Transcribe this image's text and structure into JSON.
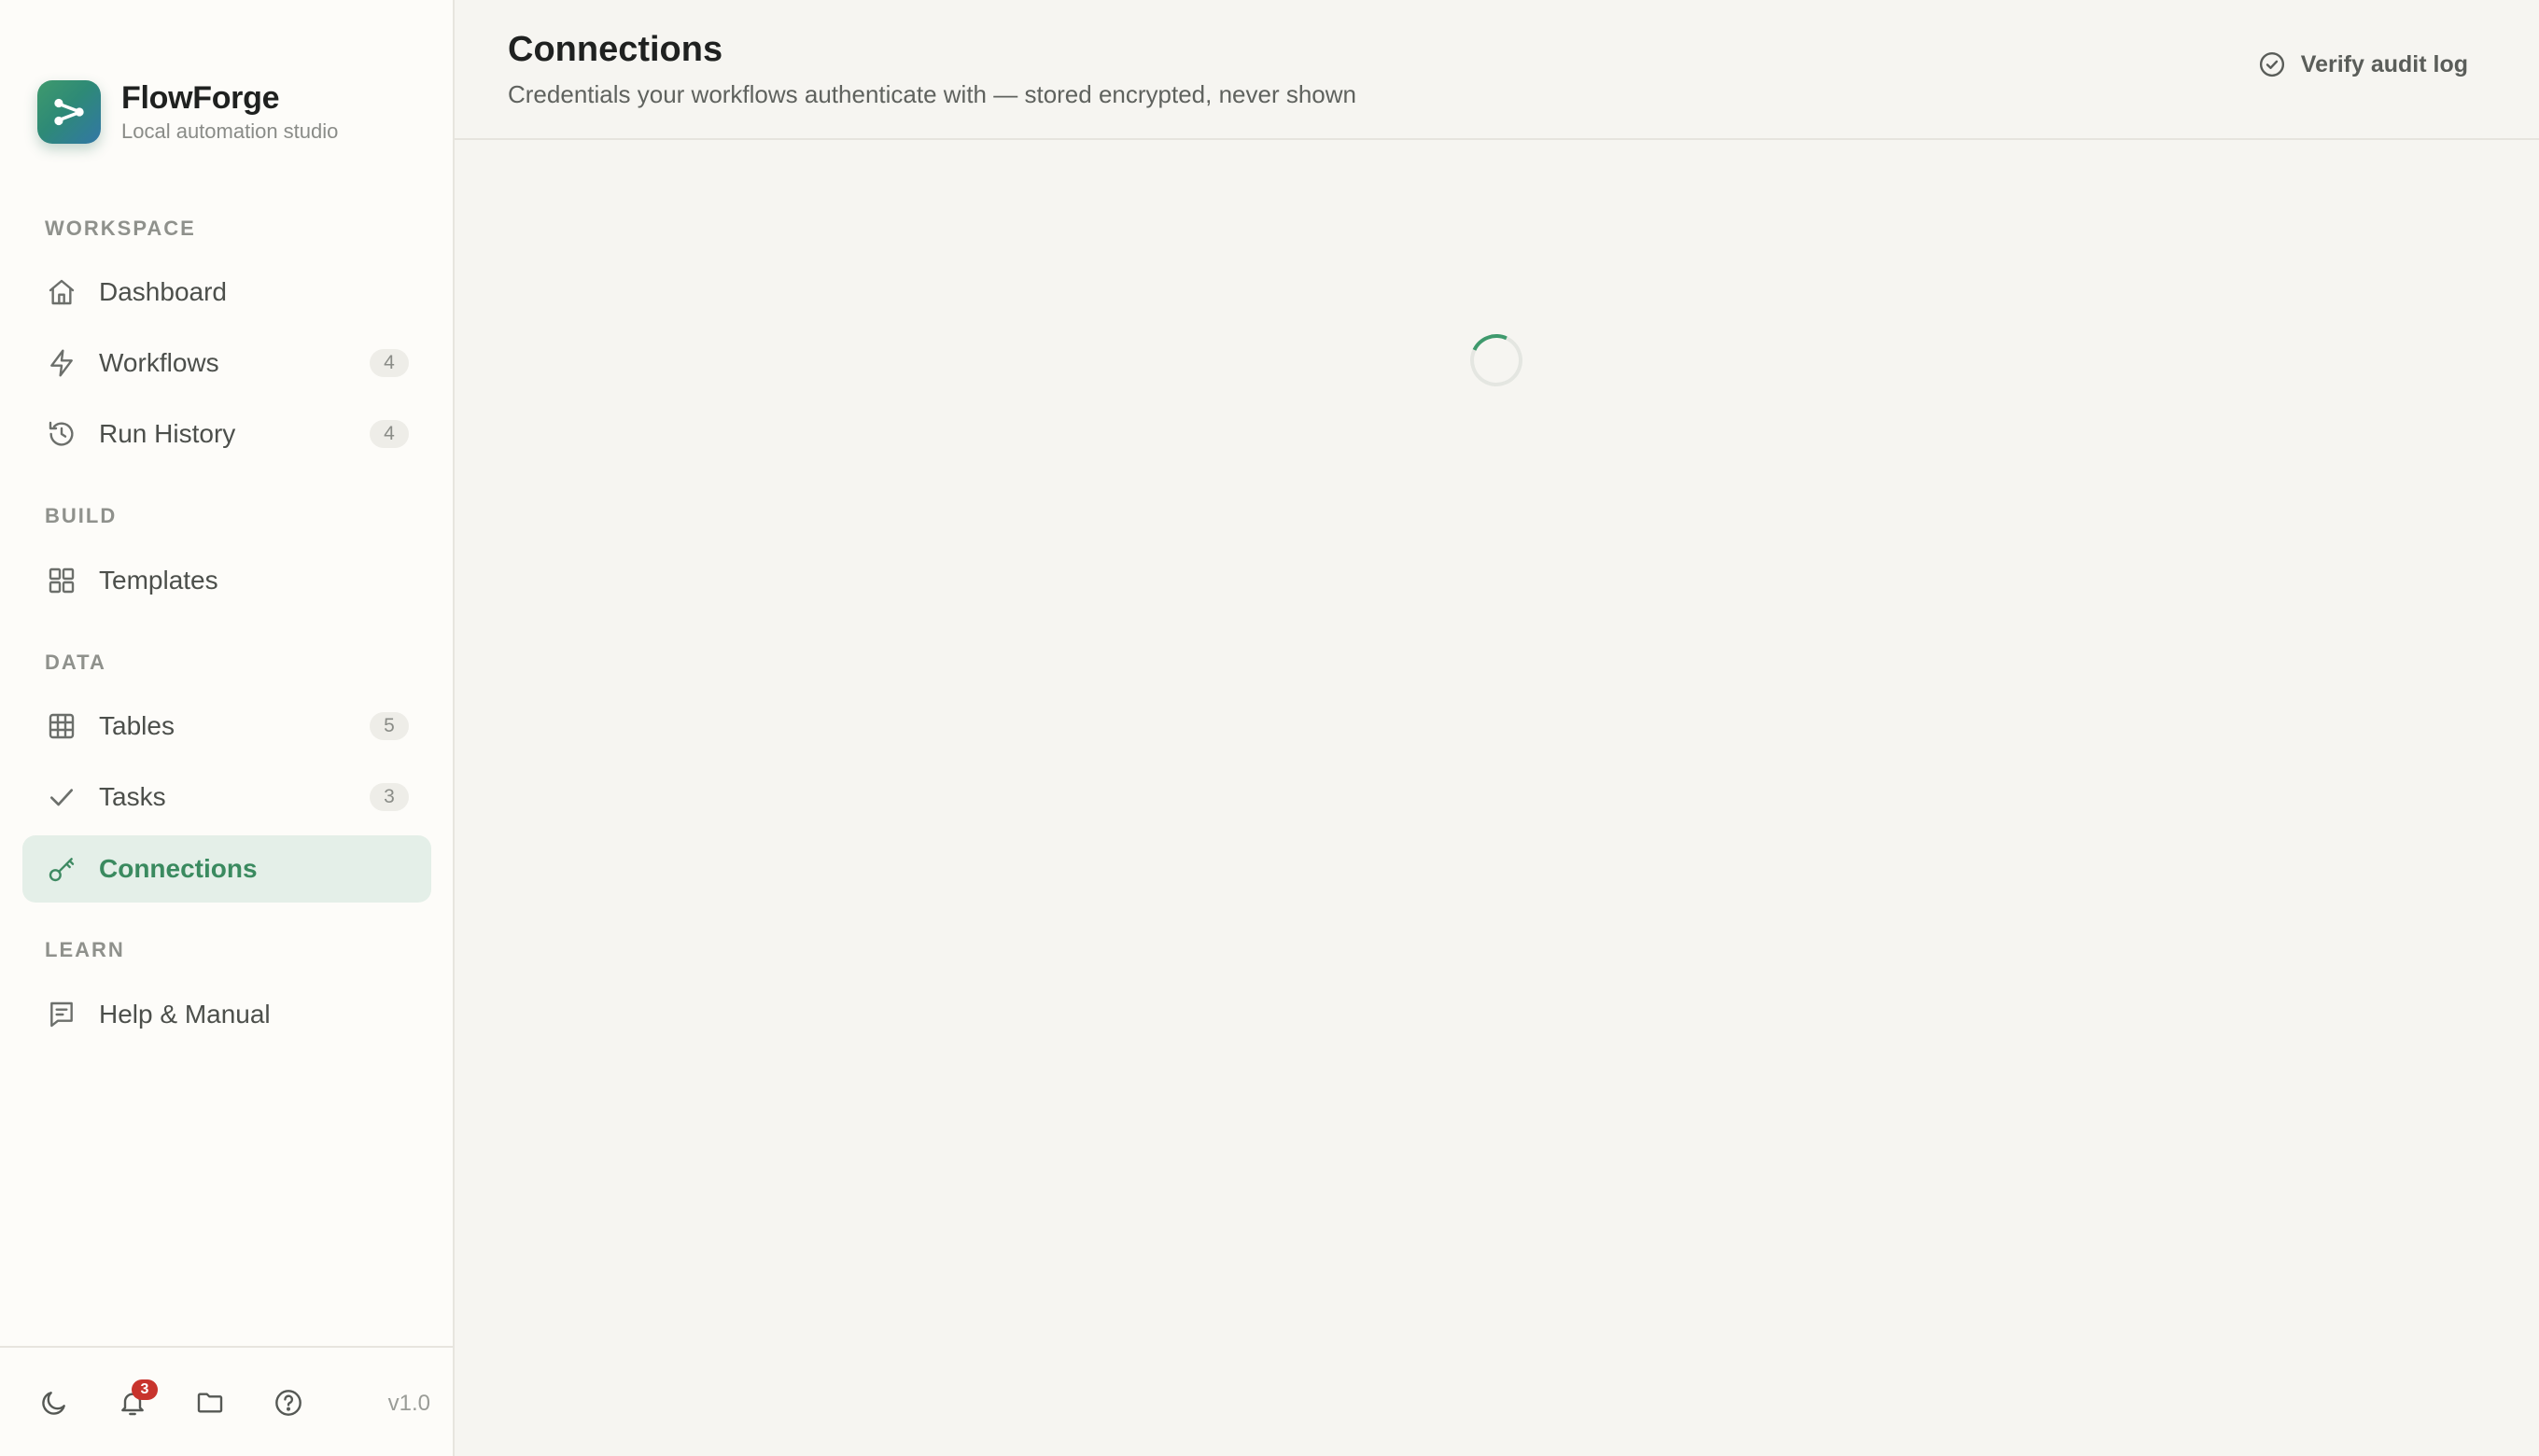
{
  "brand": {
    "name": "FlowForge",
    "subtitle": "Local automation studio"
  },
  "sidebar": {
    "sections": {
      "workspace": "WORKSPACE",
      "build": "BUILD",
      "data": "DATA",
      "learn": "LEARN"
    },
    "items": [
      {
        "label": "Dashboard",
        "icon": "home-icon"
      },
      {
        "label": "Workflows",
        "icon": "lightning-icon",
        "count": "4"
      },
      {
        "label": "Run History",
        "icon": "history-icon",
        "count": "4"
      },
      {
        "label": "Templates",
        "icon": "grid-icon"
      },
      {
        "label": "Tables",
        "icon": "table-icon",
        "count": "5"
      },
      {
        "label": "Tasks",
        "icon": "check-icon",
        "count": "3"
      },
      {
        "label": "Connections",
        "icon": "key-icon",
        "active": true
      },
      {
        "label": "Help & Manual",
        "icon": "manual-icon"
      }
    ],
    "footer": {
      "notification_count": "3",
      "version": "v1.0"
    }
  },
  "header": {
    "title": "Connections",
    "subtitle": "Credentials your workflows authenticate with — stored encrypted, never shown",
    "verify_label": "Verify audit log"
  },
  "colors": {
    "accent": "#3e8a62",
    "active_bg": "#e4efe8",
    "badge_red": "#c8342d",
    "background": "#f6f5f1"
  }
}
